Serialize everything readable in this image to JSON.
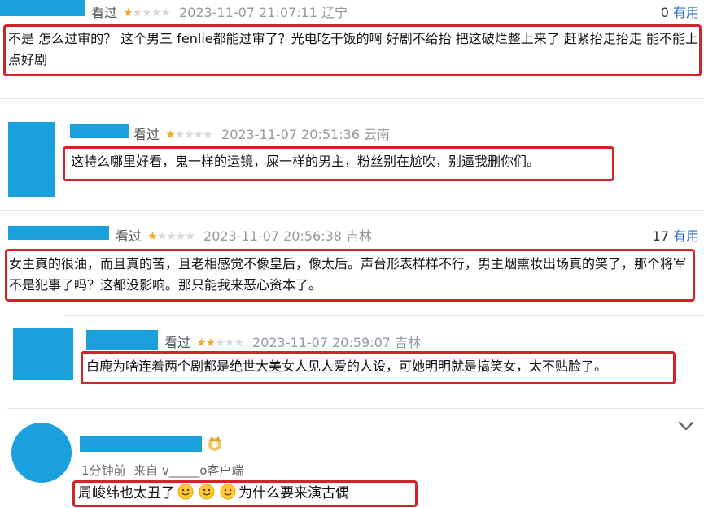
{
  "reviews": [
    {
      "seen": "看过",
      "stars_on": 1,
      "stars_total": 5,
      "datetime": "2023-11-07 21:07:11",
      "region": "辽宁",
      "useful_count": "0",
      "useful_label": "有用",
      "text": "不是 怎么过审的？ 这个男三 fenlie都能过审了？光电吃干饭的啊 好剧不给抬 把这破烂整上来了 赶紧抬走抬走 能不能上点好剧"
    },
    {
      "seen": "看过",
      "stars_on": 1,
      "stars_total": 5,
      "datetime": "2023-11-07 20:51:36",
      "region": "云南",
      "text": "这特么哪里好看，鬼一样的运镜，屎一样的男主，粉丝别在尬吹，别逼我删你们。"
    },
    {
      "seen": "看过",
      "stars_on": 1,
      "stars_total": 5,
      "datetime": "2023-11-07 20:56:38",
      "region": "吉林",
      "useful_count": "17",
      "useful_label": "有用",
      "text": "女主真的很油，而且真的苦，且老相感觉不像皇后，像太后。声台形表样样不行，男主烟熏妆出场真的笑了，那个将军不是犯事了吗？这都没影响。那只能我来恶心资本了。"
    },
    {
      "seen": "看过",
      "stars_on": 2,
      "stars_total": 5,
      "datetime": "2023-11-07 20:59:07",
      "region": "吉林",
      "text": "白鹿为啥连着两个剧都是绝世大美女人见人爱的人设，可她明明就是搞笑女，太不贴脸了。"
    }
  ],
  "weibo_comment": {
    "time_source": "1分钟前  来自 v_____o客户端",
    "text_before": "周峻纬也太丑了",
    "text_after": "为什么要来演古偶",
    "emoji_count": 3,
    "emoji_name": "smile-emoji",
    "badge_icon": "crown-badge-icon",
    "expand_icon": "chevron-down-icon"
  },
  "colors": {
    "redacted_blue": "#1aa0dc",
    "highlight_red": "#d4242a",
    "star_on": "#f5a623",
    "star_off": "#d8d8d8",
    "useful_blue": "#2a6fc9"
  }
}
